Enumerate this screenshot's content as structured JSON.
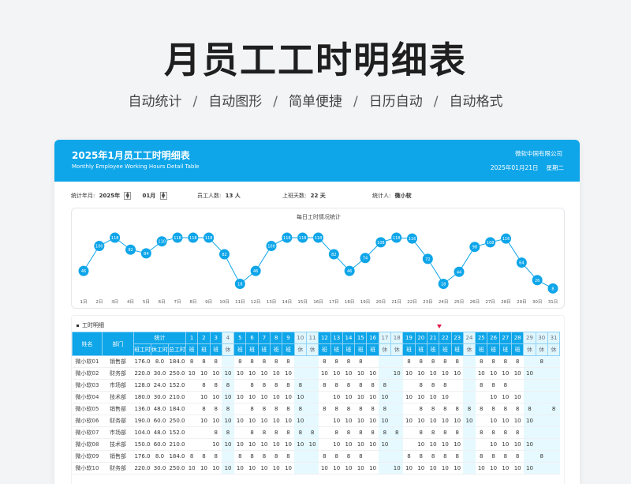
{
  "hero": {
    "title": "月员工工时明细表",
    "features": [
      "自动统计",
      "自动图形",
      "简单便捷",
      "日历自动",
      "自动格式"
    ],
    "separator": "/"
  },
  "header": {
    "title": "2025年1月员工工时明细表",
    "subtitle": "Monthly Employee Working Hours Detail Table",
    "company": "微软中国有限公司",
    "date": "2025年01月21日",
    "weekday": "星期二"
  },
  "stats": {
    "year_label": "统计年月:",
    "year": "2025年",
    "month": "01月",
    "staff_label": "员工人数:",
    "staff": "13 人",
    "days_label": "上班天数:",
    "days": "22 天",
    "counter_label": "统计人:",
    "counter": "微小软"
  },
  "chart_data": {
    "type": "line",
    "title": "每日工时情况统计",
    "x": [
      "1日",
      "2日",
      "3日",
      "4日",
      "5日",
      "6日",
      "7日",
      "8日",
      "9日",
      "10日",
      "11日",
      "12日",
      "13日",
      "14日",
      "15日",
      "16日",
      "17日",
      "18日",
      "19日",
      "20日",
      "21日",
      "22日",
      "23日",
      "24日",
      "25日",
      "26日",
      "27日",
      "28日",
      "29日",
      "30日",
      "31日"
    ],
    "values": [
      46,
      100,
      118,
      92,
      84,
      110,
      118,
      118,
      118,
      82,
      18,
      46,
      100,
      118,
      118,
      118,
      82,
      46,
      74,
      108,
      118,
      116,
      72,
      18,
      44,
      98,
      108,
      116,
      64,
      26,
      8
    ],
    "ylim": [
      0,
      130
    ],
    "line_color": "#0ea5e9"
  },
  "detail": {
    "title": "工时明细",
    "col_name": "姓名",
    "col_dept": "部门",
    "col_stats": "统计",
    "col_work": "班工时",
    "col_rest": "休工时",
    "col_total": "总工时",
    "days": [
      "1",
      "2",
      "3",
      "4",
      "5",
      "6",
      "7",
      "8",
      "9",
      "10",
      "11",
      "12",
      "13",
      "14",
      "15",
      "16",
      "17",
      "18",
      "19",
      "20",
      "21",
      "22",
      "23",
      "24",
      "25",
      "26",
      "27",
      "28",
      "29",
      "30",
      "31"
    ],
    "day_types": [
      "班",
      "班",
      "班",
      "休",
      "班",
      "班",
      "班",
      "班",
      "班",
      "休",
      "休",
      "班",
      "班",
      "班",
      "班",
      "班",
      "休",
      "休",
      "班",
      "班",
      "班",
      "班",
      "班",
      "休",
      "班",
      "班",
      "班",
      "班",
      "休",
      "休",
      "休"
    ],
    "rows": [
      {
        "name": "微小软01",
        "dept": "销售部",
        "work": "176.0",
        "rest": "8.0",
        "total": "184.0",
        "cells": [
          "8",
          "8",
          "8",
          "",
          "8",
          "8",
          "8",
          "8",
          "8",
          "",
          "",
          "8",
          "8",
          "8",
          "8",
          "",
          "",
          "",
          "8",
          "8",
          "8",
          "8",
          "8",
          "",
          "8",
          "8",
          "8",
          "8",
          "",
          "8",
          ""
        ]
      },
      {
        "name": "微小软02",
        "dept": "财务部",
        "work": "220.0",
        "rest": "30.0",
        "total": "250.0",
        "cells": [
          "10",
          "10",
          "10",
          "10",
          "10",
          "10",
          "10",
          "10",
          "10",
          "",
          "",
          "10",
          "10",
          "10",
          "10",
          "10",
          "",
          "10",
          "10",
          "10",
          "10",
          "10",
          "10",
          "",
          "10",
          "10",
          "10",
          "10",
          "10",
          "",
          ""
        ]
      },
      {
        "name": "微小软03",
        "dept": "市场部",
        "work": "128.0",
        "rest": "24.0",
        "total": "152.0",
        "cells": [
          "",
          "8",
          "8",
          "8",
          "",
          "8",
          "8",
          "8",
          "8",
          "8",
          "",
          "8",
          "8",
          "8",
          "8",
          "8",
          "8",
          "",
          "",
          "8",
          "8",
          "8",
          "",
          "",
          "8",
          "8",
          "8",
          "",
          "",
          "",
          ""
        ]
      },
      {
        "name": "微小软04",
        "dept": "技术部",
        "work": "180.0",
        "rest": "30.0",
        "total": "210.0",
        "cells": [
          "",
          "10",
          "10",
          "10",
          "10",
          "10",
          "10",
          "10",
          "10",
          "10",
          "",
          "",
          "10",
          "10",
          "10",
          "10",
          "10",
          "",
          "10",
          "10",
          "10",
          "10",
          "",
          "",
          "",
          "10",
          "10",
          "10",
          "",
          "",
          ""
        ]
      },
      {
        "name": "微小软05",
        "dept": "销售部",
        "work": "136.0",
        "rest": "48.0",
        "total": "184.0",
        "cells": [
          "",
          "8",
          "8",
          "8",
          "",
          "8",
          "8",
          "8",
          "8",
          "8",
          "",
          "8",
          "8",
          "8",
          "8",
          "8",
          "8",
          "",
          "",
          "8",
          "8",
          "8",
          "8",
          "8",
          "8",
          "8",
          "8",
          "8",
          "8",
          "",
          "8"
        ]
      },
      {
        "name": "微小软06",
        "dept": "财务部",
        "work": "190.0",
        "rest": "60.0",
        "total": "250.0",
        "cells": [
          "",
          "10",
          "10",
          "10",
          "10",
          "10",
          "10",
          "10",
          "10",
          "10",
          "",
          "",
          "10",
          "10",
          "10",
          "10",
          "10",
          "",
          "10",
          "10",
          "10",
          "10",
          "10",
          "10",
          "",
          "10",
          "10",
          "10",
          "10",
          "",
          ""
        ]
      },
      {
        "name": "微小软07",
        "dept": "市场部",
        "work": "104.0",
        "rest": "48.0",
        "total": "152.0",
        "cells": [
          "",
          "",
          "8",
          "8",
          "",
          "8",
          "8",
          "8",
          "8",
          "8",
          "8",
          "",
          "8",
          "8",
          "8",
          "8",
          "8",
          "8",
          "",
          "8",
          "8",
          "8",
          "8",
          "",
          "8",
          "8",
          "8",
          "8",
          "",
          "",
          ""
        ]
      },
      {
        "name": "微小软08",
        "dept": "技术部",
        "work": "150.0",
        "rest": "60.0",
        "total": "210.0",
        "cells": [
          "",
          "",
          "10",
          "10",
          "10",
          "10",
          "10",
          "10",
          "10",
          "10",
          "10",
          "",
          "10",
          "10",
          "10",
          "10",
          "10",
          "",
          "",
          "10",
          "10",
          "10",
          "10",
          "",
          "",
          "10",
          "10",
          "10",
          "10",
          "",
          ""
        ]
      },
      {
        "name": "微小软09",
        "dept": "销售部",
        "work": "176.0",
        "rest": "8.0",
        "total": "184.0",
        "cells": [
          "8",
          "8",
          "8",
          "",
          "8",
          "8",
          "8",
          "8",
          "8",
          "",
          "",
          "8",
          "8",
          "8",
          "8",
          "",
          "",
          "",
          "8",
          "8",
          "8",
          "8",
          "8",
          "",
          "8",
          "8",
          "8",
          "8",
          "",
          "8",
          ""
        ]
      },
      {
        "name": "微小软10",
        "dept": "财务部",
        "work": "220.0",
        "rest": "30.0",
        "total": "250.0",
        "cells": [
          "10",
          "10",
          "10",
          "10",
          "10",
          "10",
          "10",
          "10",
          "10",
          "",
          "",
          "10",
          "10",
          "10",
          "10",
          "10",
          "",
          "10",
          "10",
          "10",
          "10",
          "10",
          "10",
          "",
          "10",
          "10",
          "10",
          "10",
          "10",
          "",
          ""
        ]
      }
    ]
  }
}
